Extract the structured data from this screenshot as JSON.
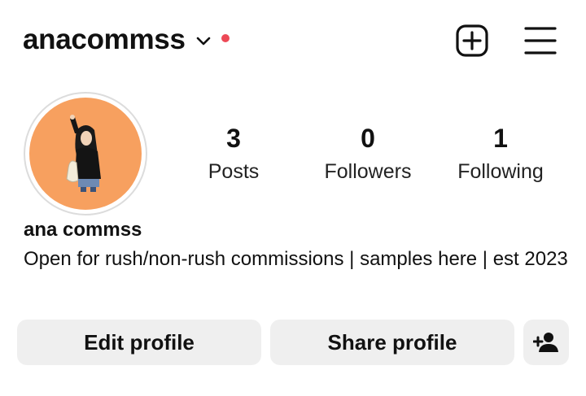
{
  "header": {
    "username": "anacommss",
    "notification_dot_color": "#ed4956",
    "new_post_icon": "plus-square-icon",
    "menu_icon": "hamburger-menu-icon"
  },
  "profile": {
    "avatar_bg_color": "#f7a05f",
    "stats": [
      {
        "value": "3",
        "label": "Posts"
      },
      {
        "value": "0",
        "label": "Followers"
      },
      {
        "value": "1",
        "label": "Following"
      }
    ],
    "display_name": "ana commss",
    "bio": "Open for rush/non-rush commissions | samples here | est 2023"
  },
  "actions": {
    "edit_label": "Edit profile",
    "share_label": "Share profile",
    "add_person_icon": "add-person-icon"
  }
}
